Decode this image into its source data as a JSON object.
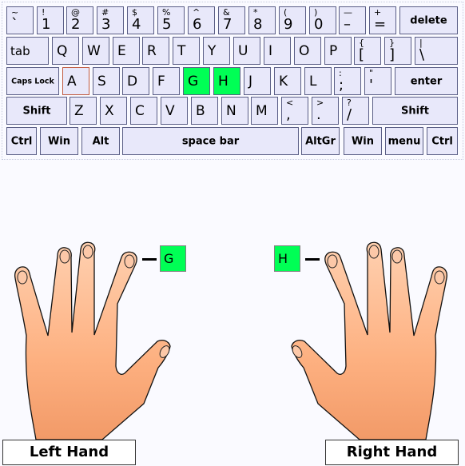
{
  "keyboard": {
    "rows": [
      [
        {
          "up": "~",
          "low": "`"
        },
        {
          "up": "!",
          "low": "1"
        },
        {
          "up": "@",
          "low": "2"
        },
        {
          "up": "#",
          "low": "3"
        },
        {
          "up": "$",
          "low": "4"
        },
        {
          "up": "%",
          "low": "5"
        },
        {
          "up": "^",
          "low": "6"
        },
        {
          "up": "&",
          "low": "7"
        },
        {
          "up": "*",
          "low": "8"
        },
        {
          "up": "(",
          "low": "9"
        },
        {
          "up": ")",
          "low": "0"
        },
        {
          "up": "—",
          "low": "–"
        },
        {
          "up": "+",
          "low": "="
        },
        {
          "word": "delete"
        }
      ],
      [
        {
          "word": "tab",
          "left": true
        },
        {
          "main": "Q"
        },
        {
          "main": "W"
        },
        {
          "main": "E"
        },
        {
          "main": "R"
        },
        {
          "main": "T"
        },
        {
          "main": "Y"
        },
        {
          "main": "U"
        },
        {
          "main": "I"
        },
        {
          "main": "O"
        },
        {
          "main": "P"
        },
        {
          "up": "{",
          "low": "["
        },
        {
          "up": "}",
          "low": "]"
        },
        {
          "up": "|",
          "low": "\\"
        }
      ],
      [
        {
          "word": "Caps Lock",
          "small": true
        },
        {
          "main": "A",
          "home": true
        },
        {
          "main": "S"
        },
        {
          "main": "D"
        },
        {
          "main": "F"
        },
        {
          "main": "G",
          "highlight": true
        },
        {
          "main": "H",
          "highlight": true
        },
        {
          "main": "J"
        },
        {
          "main": "K"
        },
        {
          "main": "L"
        },
        {
          "up": ":",
          "low": ";"
        },
        {
          "up": "\"",
          "low": "'"
        },
        {
          "word": "enter"
        }
      ],
      [
        {
          "word": "Shift"
        },
        {
          "main": "Z"
        },
        {
          "main": "X"
        },
        {
          "main": "C"
        },
        {
          "main": "V"
        },
        {
          "main": "B"
        },
        {
          "main": "N"
        },
        {
          "main": "M"
        },
        {
          "up": "<",
          "low": ","
        },
        {
          "up": ">",
          "low": "."
        },
        {
          "up": "?",
          "low": "/"
        },
        {
          "word": "Shift"
        }
      ],
      [
        {
          "word": "Ctrl"
        },
        {
          "word": "Win"
        },
        {
          "word": "Alt"
        },
        {
          "word": "space bar"
        },
        {
          "word": "AltGr"
        },
        {
          "word": "Win"
        },
        {
          "word": "menu"
        },
        {
          "word": "Ctrl"
        }
      ]
    ],
    "highlight_color": "#00ff55",
    "key_color": "#e8e8fa"
  },
  "hands": {
    "left": {
      "label": "Left Hand",
      "finger_key": "G"
    },
    "right": {
      "label": "Right Hand",
      "finger_key": "H"
    },
    "skin_color": "#fdb48a"
  }
}
